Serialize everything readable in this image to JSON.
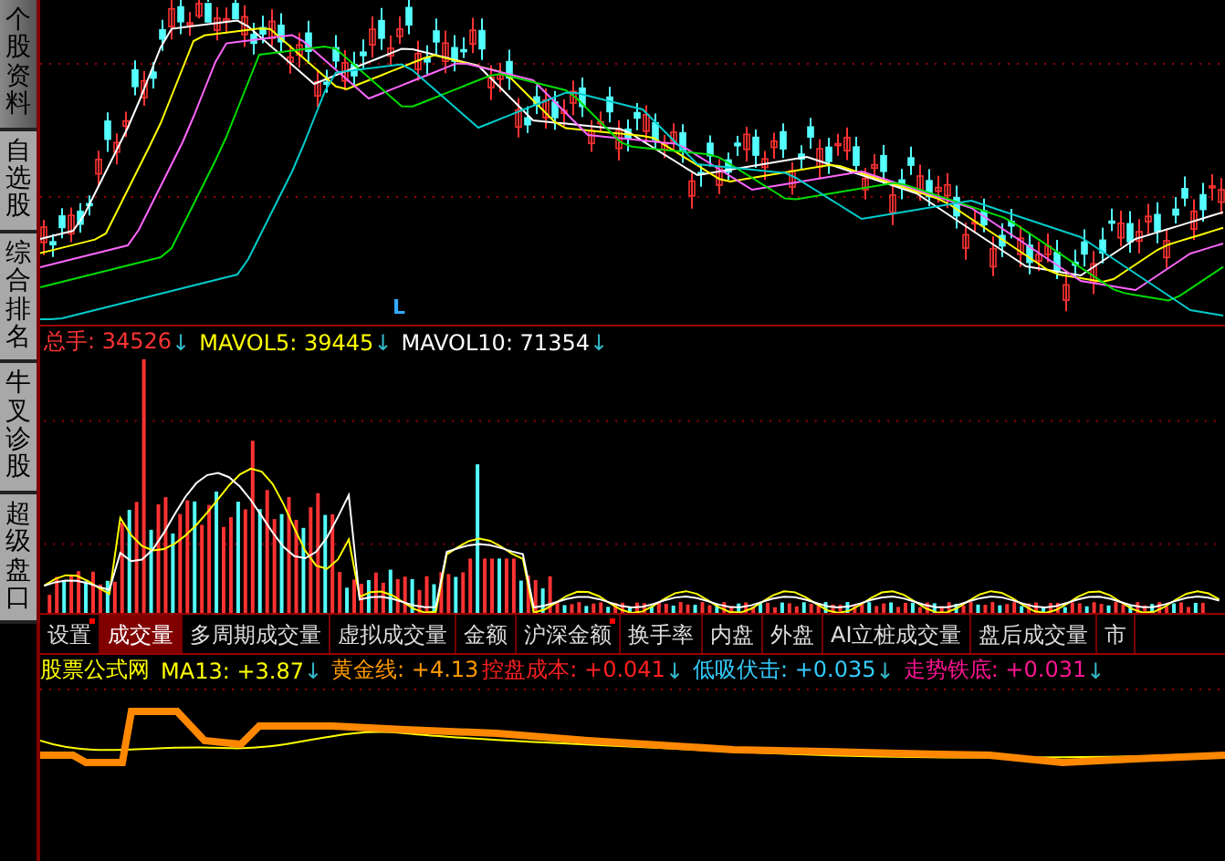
{
  "sidebar": {
    "tabs": [
      {
        "label": "个股资料",
        "selected": true
      },
      {
        "label": "自选股",
        "selected": false
      },
      {
        "label": "综合排名",
        "selected": false
      },
      {
        "label": "牛叉诊股",
        "selected": false
      },
      {
        "label": "超级盘口",
        "selected": false
      }
    ]
  },
  "price_chart": {
    "marker": "L"
  },
  "volume_panel": {
    "legend": [
      {
        "label": "总手: 34526",
        "arrow": "↓",
        "color": "#ff3333"
      },
      {
        "label": "MAVOL5: 39445",
        "arrow": "↓",
        "color": "#ffff00"
      },
      {
        "label": "MAVOL10: 71354",
        "arrow": "↓",
        "color": "#ffffff"
      }
    ]
  },
  "indicator_tabs": [
    {
      "label": "设置",
      "selected": false,
      "dot": true
    },
    {
      "label": "成交量",
      "selected": true,
      "dot": false
    },
    {
      "label": "多周期成交量",
      "selected": false,
      "dot": false
    },
    {
      "label": "虚拟成交量",
      "selected": false,
      "dot": false
    },
    {
      "label": "金额",
      "selected": false,
      "dot": false
    },
    {
      "label": "沪深金额",
      "selected": false,
      "dot": true
    },
    {
      "label": "换手率",
      "selected": false,
      "dot": false
    },
    {
      "label": "内盘",
      "selected": false,
      "dot": false
    },
    {
      "label": "外盘",
      "selected": false,
      "dot": false
    },
    {
      "label": "AI立桩成交量",
      "selected": false,
      "dot": false
    },
    {
      "label": "盘后成交量",
      "selected": false,
      "dot": false
    },
    {
      "label": "市",
      "selected": false,
      "dot": false
    }
  ],
  "indicator_panel": {
    "title": "股票公式网",
    "legend": [
      {
        "label": "MA13: +3.87",
        "arrow": "↓",
        "color": "#ffff00"
      },
      {
        "label": "黄金线: +4.13",
        "color": "#ff9900"
      },
      {
        "label": "控盘成本: +0.041",
        "arrow": "↓",
        "color": "#ff2020"
      },
      {
        "label": "低吸伏击: +0.035",
        "arrow": "↓",
        "color": "#33ccff"
      },
      {
        "label": "走势铁底: +0.031",
        "arrow": "↓",
        "color": "#ff1493"
      }
    ]
  }
}
